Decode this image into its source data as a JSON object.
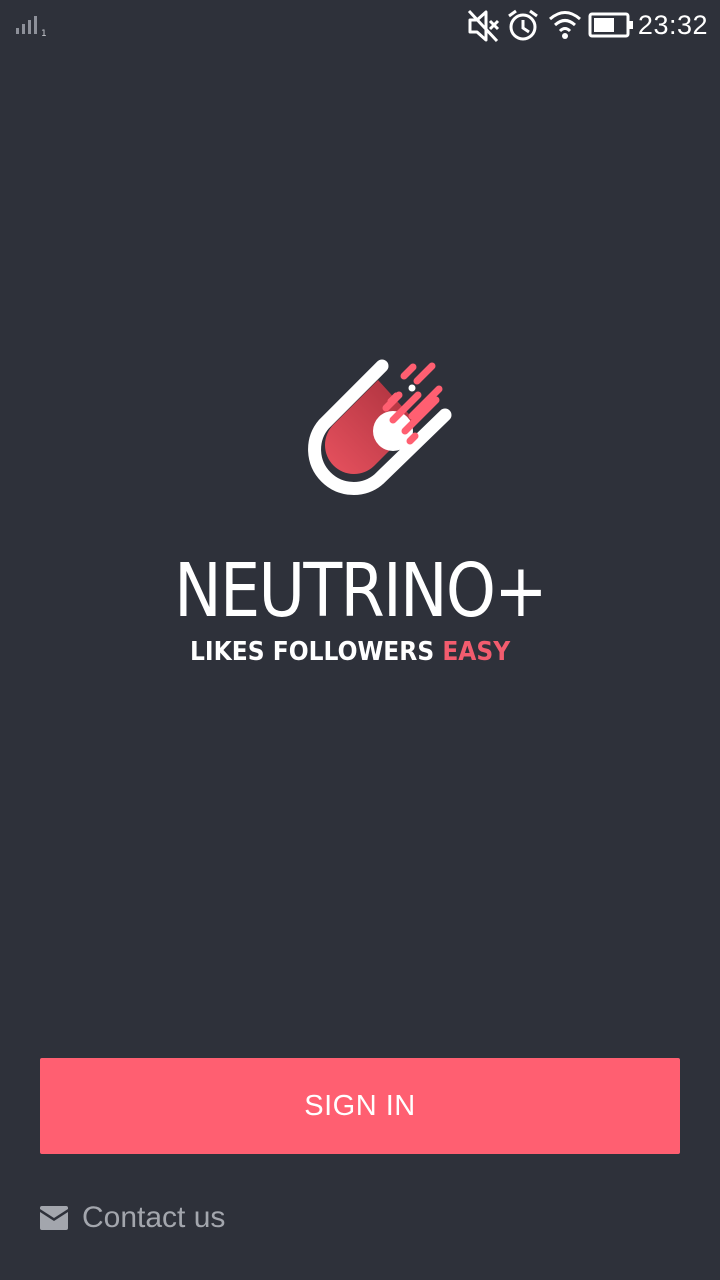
{
  "status_bar": {
    "time": "23:32",
    "icons": [
      "signal-icon",
      "mute-icon",
      "alarm-icon",
      "wifi-icon",
      "battery-icon"
    ]
  },
  "brand": {
    "name": "NEUTRINO+",
    "tagline_likes": "LIKES",
    "tagline_followers": "FOLLOWERS",
    "tagline_easy": "EASY"
  },
  "actions": {
    "sign_in_label": "SIGN IN",
    "contact_label": "Contact us"
  },
  "colors": {
    "background": "#2e313a",
    "accent": "#ff5f71",
    "text_primary": "#ffffff",
    "text_muted": "#a3a6ad"
  }
}
